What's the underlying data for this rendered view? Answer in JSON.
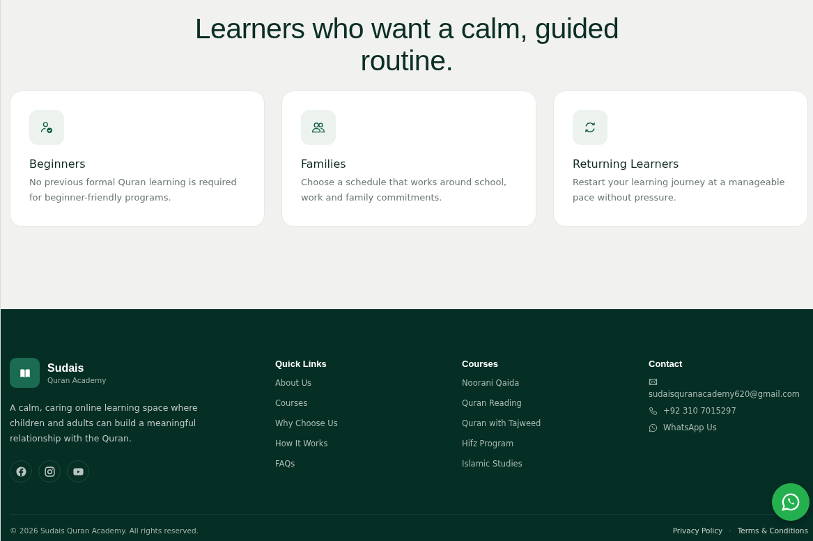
{
  "section": {
    "title": "Learners who want a calm, guided routine."
  },
  "cards": [
    {
      "kind": "user-check",
      "title": "Beginners",
      "text": "No previous formal Quran learning is required for beginner-friendly programs."
    },
    {
      "kind": "users",
      "title": "Families",
      "text": "Choose a schedule that works around school, work and family commitments."
    },
    {
      "kind": "refresh",
      "title": "Returning Learners",
      "text": "Restart your learning journey at a manageable pace without pressure."
    }
  ],
  "footer": {
    "brand": {
      "name": "Sudais",
      "tagline": "Quran Academy",
      "description": "A calm, caring online learning space where children and adults can build a meaningful relationship with the Quran.",
      "social": [
        {
          "kind": "facebook"
        },
        {
          "kind": "instagram"
        },
        {
          "kind": "youtube"
        }
      ]
    },
    "columns": [
      {
        "title": "Quick Links",
        "links": [
          "About Us",
          "Courses",
          "Why Choose Us",
          "How It Works",
          "FAQs"
        ]
      },
      {
        "title": "Courses",
        "links": [
          "Noorani Qaida",
          "Quran Reading",
          "Quran with Tajweed",
          "Hifz Program",
          "Islamic Studies"
        ]
      }
    ],
    "contact": {
      "title": "Contact",
      "items": [
        {
          "kind": "email",
          "text": "sudaisquranacademy620@gmail.com"
        },
        {
          "kind": "phone",
          "text": "+92 310 7015297"
        },
        {
          "kind": "whatsapp",
          "text": "WhatsApp Us"
        }
      ]
    },
    "copyright": "© 2026 Sudais Quran Academy. All rights reserved.",
    "legal_links": [
      "Privacy Policy",
      "Terms & Conditions"
    ],
    "separator": "·"
  },
  "floating_button": {
    "kind": "whatsapp"
  }
}
